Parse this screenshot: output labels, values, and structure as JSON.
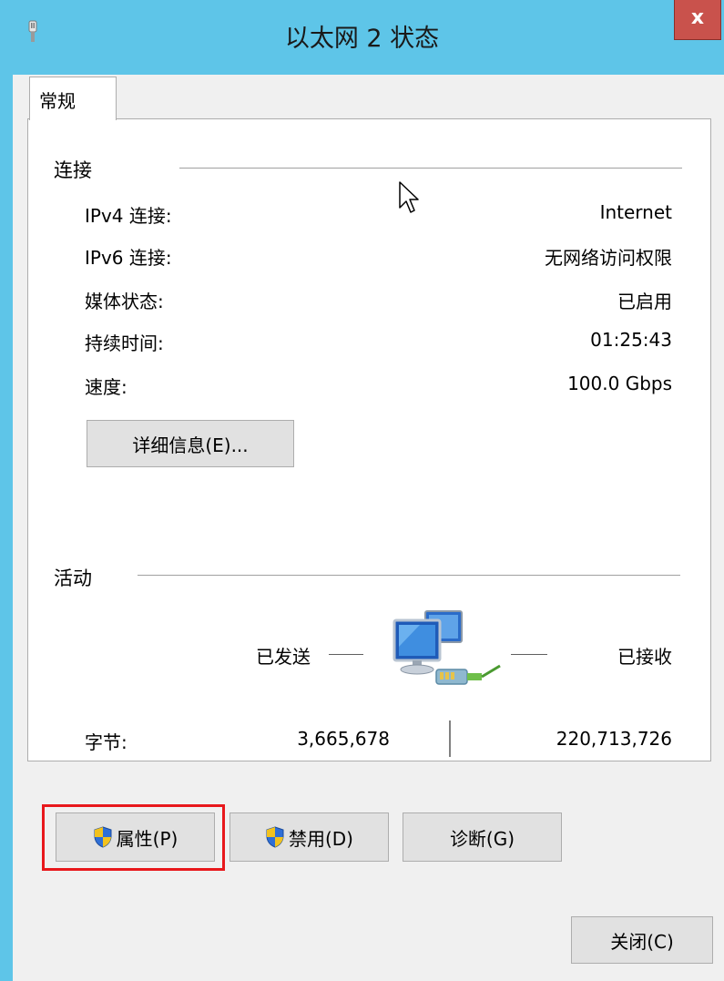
{
  "window": {
    "title": "以太网 2 状态",
    "close_label": "x"
  },
  "tabs": [
    {
      "label": "常规"
    }
  ],
  "connection": {
    "section_label": "连接",
    "rows": [
      {
        "label": "IPv4 连接:",
        "value": "Internet"
      },
      {
        "label": "IPv6 连接:",
        "value": "无网络访问权限"
      },
      {
        "label": "媒体状态:",
        "value": "已启用"
      },
      {
        "label": "持续时间:",
        "value": "01:25:43"
      },
      {
        "label": "速度:",
        "value": "100.0 Gbps"
      }
    ],
    "details_button": "详细信息(E)..."
  },
  "activity": {
    "section_label": "活动",
    "sent_label": "已发送",
    "received_label": "已接收",
    "bytes_label": "字节:",
    "bytes_sent": "3,665,678",
    "bytes_received": "220,713,726"
  },
  "buttons": {
    "properties": "属性(P)",
    "disable": "禁用(D)",
    "diagnose": "诊断(G)",
    "close": "关闭(C)"
  },
  "colors": {
    "titlebar": "#5ec5e8",
    "close_button": "#c9524c",
    "highlight": "#e8181c"
  },
  "icons": {
    "title": "network-plug-icon",
    "activity": "network-computers-icon",
    "properties": "uac-shield-icon",
    "disable": "uac-shield-icon"
  }
}
